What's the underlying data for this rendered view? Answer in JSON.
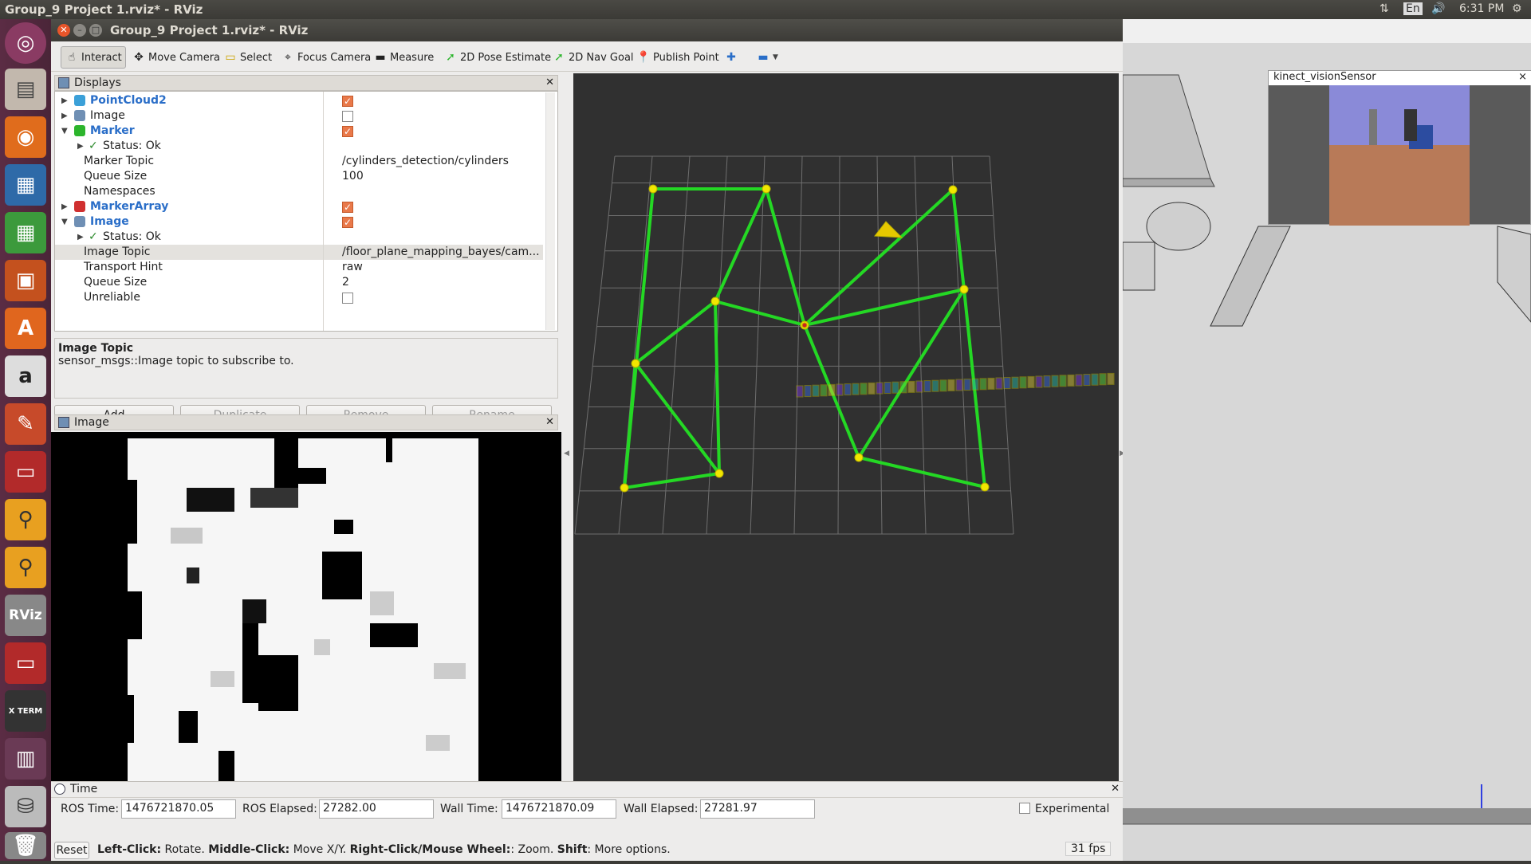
{
  "top_panel": {
    "app_title": "Group_9 Project 1.rviz* - RViz",
    "lang": "En",
    "clock": "6:31 PM"
  },
  "window": {
    "title": "Group_9 Project 1.rviz* - RViz"
  },
  "toolbar": {
    "interact": "Interact",
    "move_camera": "Move Camera",
    "select": "Select",
    "focus_camera": "Focus Camera",
    "measure": "Measure",
    "pose_estimate": "2D Pose Estimate",
    "nav_goal": "2D Nav Goal",
    "publish_point": "Publish Point"
  },
  "displays": {
    "title": "Displays",
    "rows": [
      {
        "name": "PointCloud2",
        "kind": "display",
        "checked": true
      },
      {
        "name": "Image",
        "kind": "display",
        "checked": false
      },
      {
        "name": "Marker",
        "kind": "display",
        "checked": true
      },
      {
        "name": "Status: Ok",
        "kind": "status"
      },
      {
        "name": "Marker Topic",
        "value": "/cylinders_detection/cylinders"
      },
      {
        "name": "Queue Size",
        "value": "100"
      },
      {
        "name": "Namespaces",
        "value": ""
      },
      {
        "name": "MarkerArray",
        "kind": "display",
        "checked": true
      },
      {
        "name": "Image",
        "kind": "display",
        "checked": true
      },
      {
        "name": "Status: Ok",
        "kind": "status"
      },
      {
        "name": "Image Topic",
        "value": "/floor_plane_mapping_bayes/cam..."
      },
      {
        "name": "Transport Hint",
        "value": "raw"
      },
      {
        "name": "Queue Size",
        "value": "2"
      },
      {
        "name": "Unreliable",
        "value": "",
        "checked": false
      }
    ]
  },
  "description": {
    "heading": "Image Topic",
    "text": "sensor_msgs::Image topic to subscribe to."
  },
  "buttons": {
    "add": "Add",
    "duplicate": "Duplicate",
    "remove": "Remove",
    "rename": "Rename"
  },
  "image_panel": {
    "title": "Image"
  },
  "time_panel": {
    "title": "Time",
    "ros_time_label": "ROS Time:",
    "ros_time": "1476721870.05",
    "ros_elapsed_label": "ROS Elapsed:",
    "ros_elapsed": "27282.00",
    "wall_time_label": "Wall Time:",
    "wall_time": "1476721870.09",
    "wall_elapsed_label": "Wall Elapsed:",
    "wall_elapsed": "27281.97",
    "experimental": "Experimental"
  },
  "status": {
    "reset": "Reset",
    "b1": "Left-Click:",
    "t1": " Rotate. ",
    "b2": "Middle-Click:",
    "t2": " Move X/Y. ",
    "b3": "Right-Click/Mouse Wheel:",
    "t3": ": Zoom. ",
    "b4": "Shift",
    "t4": ": More options.",
    "fps": "31 fps"
  },
  "gazebo": {
    "sensor_title": "kinect_visionSensor",
    "close": "×"
  },
  "launcher_labels": {
    "rviz": "RViz",
    "xterm": "X TERM"
  }
}
